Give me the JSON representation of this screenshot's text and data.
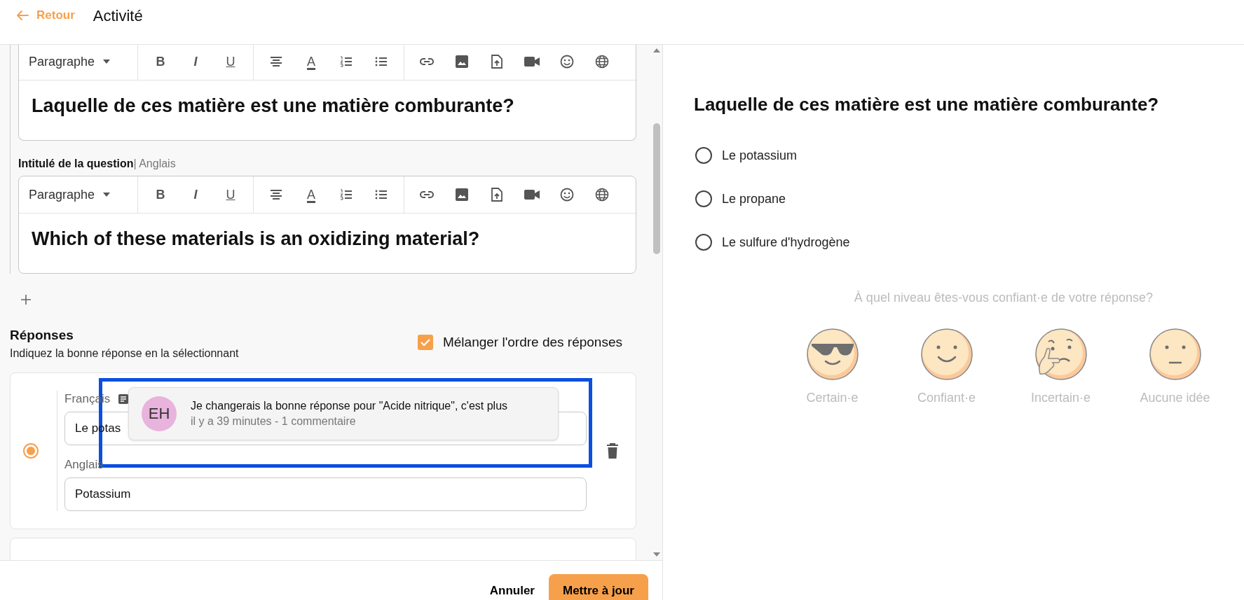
{
  "header": {
    "back_label": "Retour",
    "title": "Activité"
  },
  "editors": [
    {
      "toolbar": {
        "block_format": "Paragraphe",
        "text_buttons": [
          "B",
          "I",
          "U"
        ],
        "color_button": "A"
      },
      "content": "Laquelle de ces matière est une matière comburante?"
    },
    {
      "label": "Intitulé de la question",
      "sublabel": "| Anglais",
      "toolbar": {
        "block_format": "Paragraphe",
        "text_buttons": [
          "B",
          "I",
          "U"
        ],
        "color_button": "A"
      },
      "content": "Which of these materials is an oxidizing material?"
    }
  ],
  "answers_section": {
    "title": "Réponses",
    "hint": "Indiquez la bonne réponse en la sélectionnant",
    "shuffle": {
      "label": "Mélanger l'ordre des réponses",
      "checked": true
    }
  },
  "answers": [
    {
      "selected": true,
      "fields": [
        {
          "label": "Français",
          "value": "Le potas"
        },
        {
          "label": "Anglais",
          "value": "Potassium"
        }
      ]
    }
  ],
  "comment": {
    "initials": "EH",
    "text": "Je changerais la bonne réponse pour \"Acide nitrique\", c'est plus",
    "meta": "il y a 39 minutes - 1 commentaire"
  },
  "footer": {
    "cancel": "Annuler",
    "submit": "Mettre à jour"
  },
  "preview": {
    "question": "Laquelle de ces matière est une matière comburante?",
    "options": [
      {
        "label": "Le potassium",
        "selected": false
      },
      {
        "label": "Le propane",
        "selected": false
      },
      {
        "label": "Le sulfure d'hydrogène",
        "selected": false
      }
    ],
    "confidence": {
      "prompt": "À quel niveau êtes-vous confiant·e de votre réponse?",
      "levels": [
        {
          "label": "Certain·e",
          "kind": "cool"
        },
        {
          "label": "Confiant·e",
          "kind": "happy"
        },
        {
          "label": "Incertain·e",
          "kind": "thinking"
        },
        {
          "label": "Aucune idée",
          "kind": "neutral"
        }
      ]
    }
  }
}
